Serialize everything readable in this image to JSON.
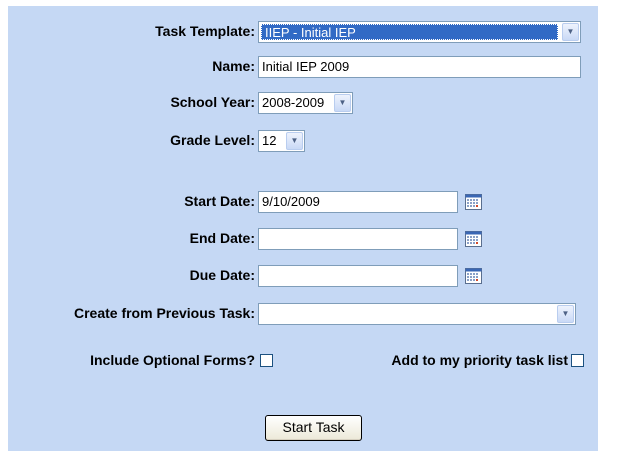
{
  "form": {
    "task_template": {
      "label": "Task Template:",
      "value": "IIEP - Initial IEP"
    },
    "name": {
      "label": "Name:",
      "value": "Initial IEP 2009"
    },
    "school_year": {
      "label": "School Year:",
      "value": "2008-2009"
    },
    "grade_level": {
      "label": "Grade Level:",
      "value": "12"
    },
    "start_date": {
      "label": "Start Date:",
      "value": "9/10/2009"
    },
    "end_date": {
      "label": "End Date:",
      "value": ""
    },
    "due_date": {
      "label": "Due Date:",
      "value": ""
    },
    "previous_task": {
      "label": "Create from Previous Task:",
      "value": ""
    },
    "include_optional_forms": {
      "label": "Include Optional Forms?",
      "checked": false
    },
    "add_priority": {
      "label": "Add to my priority task list",
      "checked": false
    },
    "start_button": {
      "label": "Start Task"
    }
  },
  "icons": {
    "dropdown": "chevron-down-icon",
    "calendar": "calendar-icon"
  },
  "colors": {
    "panel_bg": "#c5d8f4",
    "selection_bg": "#316ac5",
    "field_border": "#7f9db9"
  }
}
